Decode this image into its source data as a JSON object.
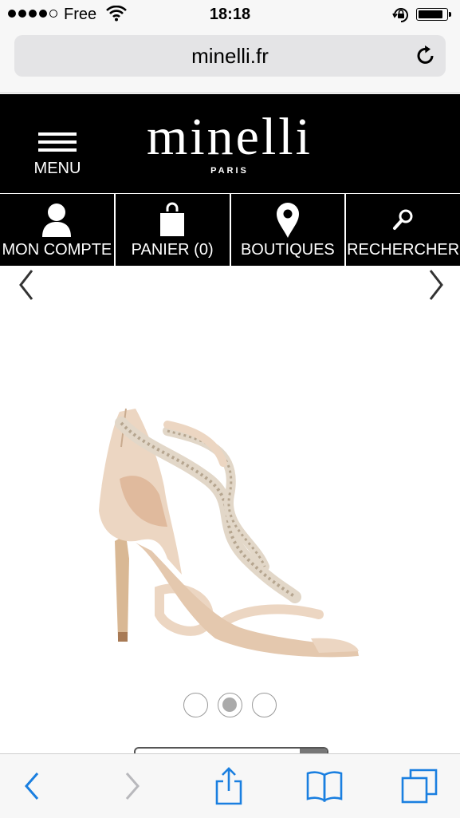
{
  "status_bar": {
    "carrier": "Free",
    "time": "18:18",
    "battery_level": 0.9
  },
  "browser": {
    "address": "minelli.fr",
    "accent_color": "#1a7fe0"
  },
  "header": {
    "menu_label": "MENU",
    "logo_text": "minelli",
    "logo_subtitle": "PARIS"
  },
  "nav": {
    "items": [
      {
        "label": "MON COMPTE",
        "icon": "user-icon"
      },
      {
        "label": "PANIER (0)",
        "icon": "shopping-bag-icon"
      },
      {
        "label": "BOUTIQUES",
        "icon": "map-pin-icon"
      },
      {
        "label": "RECHERCHER",
        "icon": "search-icon"
      }
    ]
  },
  "carousel": {
    "product_image": "beige jeweled high-heel sandal",
    "slide_count": 3,
    "active_slide": 2
  },
  "colors": {
    "header_bg": "#000000",
    "header_text": "#ffffff",
    "sandal": "#e9d4c3"
  }
}
